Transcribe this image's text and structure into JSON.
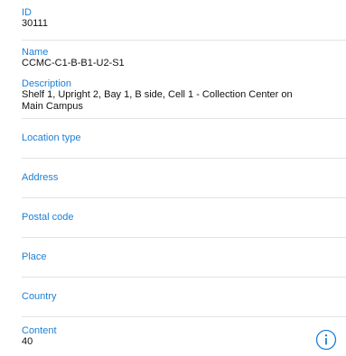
{
  "fields": {
    "id": {
      "label": "ID",
      "value": "30111"
    },
    "name": {
      "label": "Name",
      "value": "CCMC-C1-B-B1-U2-S1"
    },
    "description": {
      "label": "Description",
      "value_line1": "Shelf 1, Upright 2, Bay 1, B side, Cell 1 - Collection Center on",
      "value_line2": "Main Campus"
    },
    "location_type": {
      "label": "Location type"
    },
    "address": {
      "label": "Address"
    },
    "postal_code": {
      "label": "Postal code"
    },
    "place": {
      "label": "Place"
    },
    "country": {
      "label": "Country"
    },
    "content": {
      "label": "Content",
      "value": "40"
    }
  },
  "colors": {
    "accent": "#1b7fd6",
    "separator": "#e3e3e8"
  },
  "icons": {
    "info": "info-circle-icon"
  }
}
